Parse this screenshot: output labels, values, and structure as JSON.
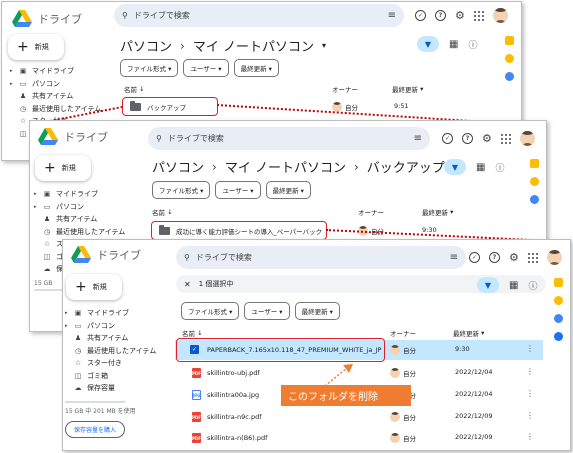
{
  "app": {
    "title": "ドライブ",
    "search_placeholder": "ドライブで検索"
  },
  "common": {
    "new_label": "新規",
    "filters": [
      "ファイル形式",
      "ユーザー",
      "最終更新"
    ],
    "col_name": "名前",
    "col_owner": "オーナー",
    "col_modified": "最終更新",
    "sidebar": [
      {
        "label": "マイドライブ",
        "icon": "drive-icon"
      },
      {
        "label": "パソコン",
        "icon": "computer-icon"
      },
      {
        "label": "共有アイテム",
        "icon": "shared-icon"
      },
      {
        "label": "最近使用したアイテム",
        "icon": "clock-icon"
      },
      {
        "label": "スター付き",
        "icon": "star-icon"
      },
      {
        "label": "ゴミ箱",
        "icon": "trash-icon"
      },
      {
        "label": "保存容量",
        "icon": "cloud-icon"
      }
    ],
    "storage_short": "15 GB",
    "storage_full": "15 GB 中 201 MB を使用",
    "buy_storage": "保存容量を購入"
  },
  "window1": {
    "breadcrumb": [
      "パソコン",
      "マイ ノートパソコン"
    ],
    "row": {
      "name": "バックアップ",
      "owner": "自分",
      "modified": "9:51"
    }
  },
  "window2": {
    "breadcrumb": [
      "パソコン",
      "マイ ノートパソコン",
      "バックアップ"
    ],
    "row": {
      "name": "成功に導く能力評価シートの導入_ペーパーバック",
      "owner": "自分",
      "modified": "9:30"
    },
    "sidebar_recent": "最近使用したアイテム"
  },
  "window3": {
    "selection": "1 個選択中",
    "files": [
      {
        "name": "PAPERBACK_7.165x10.118_47_PREMIUM_WHITE_ja_JP",
        "owner": "自分",
        "modified": "9:30",
        "type": "selected"
      },
      {
        "name": "skillintro-ubj.pdf",
        "owner": "自分",
        "modified": "2022/12/04",
        "type": "pdf"
      },
      {
        "name": "skillintra00a.jpg",
        "owner": "自分",
        "modified": "2022/12/04",
        "type": "jpg"
      },
      {
        "name": "skillintra-n9c.pdf",
        "owner": "自分",
        "modified": "2022/12/09",
        "type": "pdf"
      },
      {
        "name": "skillintra-n(B6).pdf",
        "owner": "自分",
        "modified": "2022/12/09",
        "type": "pdf"
      }
    ]
  },
  "callout": {
    "text": "このフォルダを削除",
    "color": "#ef7d31"
  },
  "colors": {
    "accent": "#0b57d0",
    "highlight": "#e21f26",
    "selected_row": "#c2e7ff"
  }
}
